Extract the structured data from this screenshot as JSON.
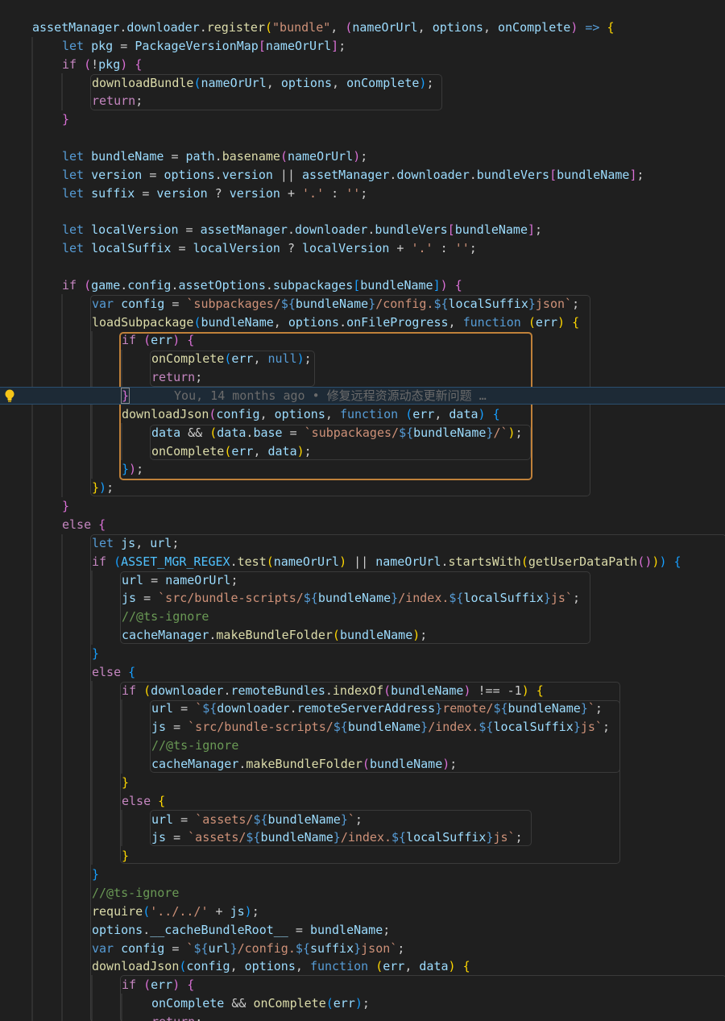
{
  "blame": "You, 14 months ago • 修复远程资源动态更新问题 …",
  "lines": [
    [
      [
        "v",
        "assetManager"
      ],
      [
        "p",
        "."
      ],
      [
        "v",
        "downloader"
      ],
      [
        "p",
        "."
      ],
      [
        "f",
        "register"
      ],
      [
        "b1",
        "("
      ],
      [
        "s",
        "\"bundle\""
      ],
      [
        "p",
        ", "
      ],
      [
        "b2",
        "("
      ],
      [
        "v",
        "nameOrUrl"
      ],
      [
        "p",
        ", "
      ],
      [
        "v",
        "options"
      ],
      [
        "p",
        ", "
      ],
      [
        "v",
        "onComplete"
      ],
      [
        "b2",
        ")"
      ],
      [
        "p",
        " "
      ],
      [
        "k",
        "=>"
      ],
      [
        "p",
        " "
      ],
      [
        "b1",
        "{"
      ]
    ],
    [
      [
        "k",
        "let"
      ],
      [
        "p",
        " "
      ],
      [
        "v",
        "pkg"
      ],
      [
        "p",
        " = "
      ],
      [
        "v",
        "PackageVersionMap"
      ],
      [
        "b2",
        "["
      ],
      [
        "v",
        "nameOrUrl"
      ],
      [
        "b2",
        "]"
      ],
      [
        "p",
        ";"
      ]
    ],
    [
      [
        "kc",
        "if"
      ],
      [
        "p",
        " "
      ],
      [
        "b2",
        "("
      ],
      [
        "p",
        "!"
      ],
      [
        "v",
        "pkg"
      ],
      [
        "b2",
        ")"
      ],
      [
        "p",
        " "
      ],
      [
        "b2",
        "{"
      ]
    ],
    [
      [
        "f",
        "downloadBundle"
      ],
      [
        "b3",
        "("
      ],
      [
        "v",
        "nameOrUrl"
      ],
      [
        "p",
        ", "
      ],
      [
        "v",
        "options"
      ],
      [
        "p",
        ", "
      ],
      [
        "v",
        "onComplete"
      ],
      [
        "b3",
        ")"
      ],
      [
        "p",
        ";"
      ]
    ],
    [
      [
        "kc",
        "return"
      ],
      [
        "p",
        ";"
      ]
    ],
    [
      [
        "b2",
        "}"
      ]
    ],
    [],
    [
      [
        "k",
        "let"
      ],
      [
        "p",
        " "
      ],
      [
        "v",
        "bundleName"
      ],
      [
        "p",
        " = "
      ],
      [
        "v",
        "path"
      ],
      [
        "p",
        "."
      ],
      [
        "f",
        "basename"
      ],
      [
        "b2",
        "("
      ],
      [
        "v",
        "nameOrUrl"
      ],
      [
        "b2",
        ")"
      ],
      [
        "p",
        ";"
      ]
    ],
    [
      [
        "k",
        "let"
      ],
      [
        "p",
        " "
      ],
      [
        "v",
        "version"
      ],
      [
        "p",
        " = "
      ],
      [
        "v",
        "options"
      ],
      [
        "p",
        "."
      ],
      [
        "v",
        "version"
      ],
      [
        "p",
        " || "
      ],
      [
        "v",
        "assetManager"
      ],
      [
        "p",
        "."
      ],
      [
        "v",
        "downloader"
      ],
      [
        "p",
        "."
      ],
      [
        "v",
        "bundleVers"
      ],
      [
        "b2",
        "["
      ],
      [
        "v",
        "bundleName"
      ],
      [
        "b2",
        "]"
      ],
      [
        "p",
        ";"
      ]
    ],
    [
      [
        "k",
        "let"
      ],
      [
        "p",
        " "
      ],
      [
        "v",
        "suffix"
      ],
      [
        "p",
        " = "
      ],
      [
        "v",
        "version"
      ],
      [
        "p",
        " ? "
      ],
      [
        "v",
        "version"
      ],
      [
        "p",
        " + "
      ],
      [
        "s",
        "'.'"
      ],
      [
        "p",
        " : "
      ],
      [
        "s",
        "''"
      ],
      [
        "p",
        ";"
      ]
    ],
    [],
    [
      [
        "k",
        "let"
      ],
      [
        "p",
        " "
      ],
      [
        "v",
        "localVersion"
      ],
      [
        "p",
        " = "
      ],
      [
        "v",
        "assetManager"
      ],
      [
        "p",
        "."
      ],
      [
        "v",
        "downloader"
      ],
      [
        "p",
        "."
      ],
      [
        "v",
        "bundleVers"
      ],
      [
        "b2",
        "["
      ],
      [
        "v",
        "bundleName"
      ],
      [
        "b2",
        "]"
      ],
      [
        "p",
        ";"
      ]
    ],
    [
      [
        "k",
        "let"
      ],
      [
        "p",
        " "
      ],
      [
        "v",
        "localSuffix"
      ],
      [
        "p",
        " = "
      ],
      [
        "v",
        "localVersion"
      ],
      [
        "p",
        " ? "
      ],
      [
        "v",
        "localVersion"
      ],
      [
        "p",
        " + "
      ],
      [
        "s",
        "'.'"
      ],
      [
        "p",
        " : "
      ],
      [
        "s",
        "''"
      ],
      [
        "p",
        ";"
      ]
    ],
    [],
    [
      [
        "kc",
        "if"
      ],
      [
        "p",
        " "
      ],
      [
        "b2",
        "("
      ],
      [
        "v",
        "game"
      ],
      [
        "p",
        "."
      ],
      [
        "v",
        "config"
      ],
      [
        "p",
        "."
      ],
      [
        "v",
        "assetOptions"
      ],
      [
        "p",
        "."
      ],
      [
        "v",
        "subpackages"
      ],
      [
        "b3",
        "["
      ],
      [
        "v",
        "bundleName"
      ],
      [
        "b3",
        "]"
      ],
      [
        "b2",
        ")"
      ],
      [
        "p",
        " "
      ],
      [
        "b2",
        "{"
      ]
    ],
    [
      [
        "k",
        "var"
      ],
      [
        "p",
        " "
      ],
      [
        "v",
        "config"
      ],
      [
        "p",
        " = "
      ],
      [
        "s",
        "`subpackages/"
      ],
      [
        "k",
        "${"
      ],
      [
        "v",
        "bundleName"
      ],
      [
        "k",
        "}"
      ],
      [
        "s",
        "/config."
      ],
      [
        "k",
        "${"
      ],
      [
        "v",
        "localSuffix"
      ],
      [
        "k",
        "}"
      ],
      [
        "s",
        "json`"
      ],
      [
        "p",
        ";"
      ]
    ],
    [
      [
        "f",
        "loadSubpackage"
      ],
      [
        "b3",
        "("
      ],
      [
        "v",
        "bundleName"
      ],
      [
        "p",
        ", "
      ],
      [
        "v",
        "options"
      ],
      [
        "p",
        "."
      ],
      [
        "v",
        "onFileProgress"
      ],
      [
        "p",
        ", "
      ],
      [
        "k",
        "function"
      ],
      [
        "p",
        " "
      ],
      [
        "b1",
        "("
      ],
      [
        "v",
        "err"
      ],
      [
        "b1",
        ")"
      ],
      [
        "p",
        " "
      ],
      [
        "b1",
        "{"
      ]
    ],
    [
      [
        "kc",
        "if"
      ],
      [
        "p",
        " "
      ],
      [
        "b2",
        "("
      ],
      [
        "v",
        "err"
      ],
      [
        "b2",
        ")"
      ],
      [
        "p",
        " "
      ],
      [
        "b2",
        "{"
      ]
    ],
    [
      [
        "f",
        "onComplete"
      ],
      [
        "b3",
        "("
      ],
      [
        "v",
        "err"
      ],
      [
        "p",
        ", "
      ],
      [
        "n",
        "null"
      ],
      [
        "b3",
        ")"
      ],
      [
        "p",
        ";"
      ]
    ],
    [
      [
        "kc",
        "return"
      ],
      [
        "p",
        ";"
      ]
    ],
    [
      [
        "b2",
        "}"
      ]
    ],
    [
      [
        "f",
        "downloadJson"
      ],
      [
        "b2",
        "("
      ],
      [
        "v",
        "config"
      ],
      [
        "p",
        ", "
      ],
      [
        "v",
        "options"
      ],
      [
        "p",
        ", "
      ],
      [
        "k",
        "function"
      ],
      [
        "p",
        " "
      ],
      [
        "b3",
        "("
      ],
      [
        "v",
        "err"
      ],
      [
        "p",
        ", "
      ],
      [
        "v",
        "data"
      ],
      [
        "b3",
        ")"
      ],
      [
        "p",
        " "
      ],
      [
        "b3",
        "{"
      ]
    ],
    [
      [
        "v",
        "data"
      ],
      [
        "p",
        " && "
      ],
      [
        "b1",
        "("
      ],
      [
        "v",
        "data"
      ],
      [
        "p",
        "."
      ],
      [
        "v",
        "base"
      ],
      [
        "p",
        " = "
      ],
      [
        "s",
        "`subpackages/"
      ],
      [
        "k",
        "${"
      ],
      [
        "v",
        "bundleName"
      ],
      [
        "k",
        "}"
      ],
      [
        "s",
        "/`"
      ],
      [
        "b1",
        ")"
      ],
      [
        "p",
        ";"
      ]
    ],
    [
      [
        "f",
        "onComplete"
      ],
      [
        "b1",
        "("
      ],
      [
        "v",
        "err"
      ],
      [
        "p",
        ", "
      ],
      [
        "v",
        "data"
      ],
      [
        "b1",
        ")"
      ],
      [
        "p",
        ";"
      ]
    ],
    [
      [
        "b3",
        "}"
      ],
      [
        "b2",
        ")"
      ],
      [
        "p",
        ";"
      ]
    ],
    [
      [
        "b1",
        "}"
      ],
      [
        "b3",
        ")"
      ],
      [
        "p",
        ";"
      ]
    ],
    [
      [
        "b2",
        "}"
      ]
    ],
    [
      [
        "kc",
        "else"
      ],
      [
        "p",
        " "
      ],
      [
        "b2",
        "{"
      ]
    ],
    [
      [
        "k",
        "let"
      ],
      [
        "p",
        " "
      ],
      [
        "v",
        "js"
      ],
      [
        "p",
        ", "
      ],
      [
        "v",
        "url"
      ],
      [
        "p",
        ";"
      ]
    ],
    [
      [
        "kc",
        "if"
      ],
      [
        "p",
        " "
      ],
      [
        "b3",
        "("
      ],
      [
        "cn",
        "ASSET_MGR_REGEX"
      ],
      [
        "p",
        "."
      ],
      [
        "f",
        "test"
      ],
      [
        "b1",
        "("
      ],
      [
        "v",
        "nameOrUrl"
      ],
      [
        "b1",
        ")"
      ],
      [
        "p",
        " || "
      ],
      [
        "v",
        "nameOrUrl"
      ],
      [
        "p",
        "."
      ],
      [
        "f",
        "startsWith"
      ],
      [
        "b1",
        "("
      ],
      [
        "f",
        "getUserDataPath"
      ],
      [
        "b2",
        "()"
      ],
      [
        "b1",
        ")"
      ],
      [
        "b3",
        ")"
      ],
      [
        "p",
        " "
      ],
      [
        "b3",
        "{"
      ]
    ],
    [
      [
        "v",
        "url"
      ],
      [
        "p",
        " = "
      ],
      [
        "v",
        "nameOrUrl"
      ],
      [
        "p",
        ";"
      ]
    ],
    [
      [
        "v",
        "js"
      ],
      [
        "p",
        " = "
      ],
      [
        "s",
        "`src/bundle-scripts/"
      ],
      [
        "k",
        "${"
      ],
      [
        "v",
        "bundleName"
      ],
      [
        "k",
        "}"
      ],
      [
        "s",
        "/index."
      ],
      [
        "k",
        "${"
      ],
      [
        "v",
        "localSuffix"
      ],
      [
        "k",
        "}"
      ],
      [
        "s",
        "js`"
      ],
      [
        "p",
        ";"
      ]
    ],
    [
      [
        "c",
        "//@ts-ignore"
      ]
    ],
    [
      [
        "v",
        "cacheManager"
      ],
      [
        "p",
        "."
      ],
      [
        "f",
        "makeBundleFolder"
      ],
      [
        "b1",
        "("
      ],
      [
        "v",
        "bundleName"
      ],
      [
        "b1",
        ")"
      ],
      [
        "p",
        ";"
      ]
    ],
    [
      [
        "b3",
        "}"
      ]
    ],
    [
      [
        "kc",
        "else"
      ],
      [
        "p",
        " "
      ],
      [
        "b3",
        "{"
      ]
    ],
    [
      [
        "kc",
        "if"
      ],
      [
        "p",
        " "
      ],
      [
        "b1",
        "("
      ],
      [
        "v",
        "downloader"
      ],
      [
        "p",
        "."
      ],
      [
        "v",
        "remoteBundles"
      ],
      [
        "p",
        "."
      ],
      [
        "f",
        "indexOf"
      ],
      [
        "b2",
        "("
      ],
      [
        "v",
        "bundleName"
      ],
      [
        "b2",
        ")"
      ],
      [
        "p",
        " !== -1"
      ],
      [
        "b1",
        ")"
      ],
      [
        "p",
        " "
      ],
      [
        "b1",
        "{"
      ]
    ],
    [
      [
        "v",
        "url"
      ],
      [
        "p",
        " = "
      ],
      [
        "s",
        "`"
      ],
      [
        "k",
        "${"
      ],
      [
        "v",
        "downloader"
      ],
      [
        "p",
        "."
      ],
      [
        "v",
        "remoteServerAddress"
      ],
      [
        "k",
        "}"
      ],
      [
        "s",
        "remote/"
      ],
      [
        "k",
        "${"
      ],
      [
        "v",
        "bundleName"
      ],
      [
        "k",
        "}"
      ],
      [
        "s",
        "`"
      ],
      [
        "p",
        ";"
      ]
    ],
    [
      [
        "v",
        "js"
      ],
      [
        "p",
        " = "
      ],
      [
        "s",
        "`src/bundle-scripts/"
      ],
      [
        "k",
        "${"
      ],
      [
        "v",
        "bundleName"
      ],
      [
        "k",
        "}"
      ],
      [
        "s",
        "/index."
      ],
      [
        "k",
        "${"
      ],
      [
        "v",
        "localSuffix"
      ],
      [
        "k",
        "}"
      ],
      [
        "s",
        "js`"
      ],
      [
        "p",
        ";"
      ]
    ],
    [
      [
        "c",
        "//@ts-ignore"
      ]
    ],
    [
      [
        "v",
        "cacheManager"
      ],
      [
        "p",
        "."
      ],
      [
        "f",
        "makeBundleFolder"
      ],
      [
        "b2",
        "("
      ],
      [
        "v",
        "bundleName"
      ],
      [
        "b2",
        ")"
      ],
      [
        "p",
        ";"
      ]
    ],
    [
      [
        "b1",
        "}"
      ]
    ],
    [
      [
        "kc",
        "else"
      ],
      [
        "p",
        " "
      ],
      [
        "b1",
        "{"
      ]
    ],
    [
      [
        "v",
        "url"
      ],
      [
        "p",
        " = "
      ],
      [
        "s",
        "`assets/"
      ],
      [
        "k",
        "${"
      ],
      [
        "v",
        "bundleName"
      ],
      [
        "k",
        "}"
      ],
      [
        "s",
        "`"
      ],
      [
        "p",
        ";"
      ]
    ],
    [
      [
        "v",
        "js"
      ],
      [
        "p",
        " = "
      ],
      [
        "s",
        "`assets/"
      ],
      [
        "k",
        "${"
      ],
      [
        "v",
        "bundleName"
      ],
      [
        "k",
        "}"
      ],
      [
        "s",
        "/index."
      ],
      [
        "k",
        "${"
      ],
      [
        "v",
        "localSuffix"
      ],
      [
        "k",
        "}"
      ],
      [
        "s",
        "js`"
      ],
      [
        "p",
        ";"
      ]
    ],
    [
      [
        "b1",
        "}"
      ]
    ],
    [
      [
        "b3",
        "}"
      ]
    ],
    [
      [
        "c",
        "//@ts-ignore"
      ]
    ],
    [
      [
        "f",
        "require"
      ],
      [
        "b3",
        "("
      ],
      [
        "s",
        "'../../'"
      ],
      [
        "p",
        " + "
      ],
      [
        "v",
        "js"
      ],
      [
        "b3",
        ")"
      ],
      [
        "p",
        ";"
      ]
    ],
    [
      [
        "v",
        "options"
      ],
      [
        "p",
        "."
      ],
      [
        "v",
        "__cacheBundleRoot__"
      ],
      [
        "p",
        " = "
      ],
      [
        "v",
        "bundleName"
      ],
      [
        "p",
        ";"
      ]
    ],
    [
      [
        "k",
        "var"
      ],
      [
        "p",
        " "
      ],
      [
        "v",
        "config"
      ],
      [
        "p",
        " = "
      ],
      [
        "s",
        "`"
      ],
      [
        "k",
        "${"
      ],
      [
        "v",
        "url"
      ],
      [
        "k",
        "}"
      ],
      [
        "s",
        "/config."
      ],
      [
        "k",
        "${"
      ],
      [
        "v",
        "suffix"
      ],
      [
        "k",
        "}"
      ],
      [
        "s",
        "json`"
      ],
      [
        "p",
        ";"
      ]
    ],
    [
      [
        "f",
        "downloadJson"
      ],
      [
        "b3",
        "("
      ],
      [
        "v",
        "config"
      ],
      [
        "p",
        ", "
      ],
      [
        "v",
        "options"
      ],
      [
        "p",
        ", "
      ],
      [
        "k",
        "function"
      ],
      [
        "p",
        " "
      ],
      [
        "b1",
        "("
      ],
      [
        "v",
        "err"
      ],
      [
        "p",
        ", "
      ],
      [
        "v",
        "data"
      ],
      [
        "b1",
        ")"
      ],
      [
        "p",
        " "
      ],
      [
        "b1",
        "{"
      ]
    ],
    [
      [
        "kc",
        "if"
      ],
      [
        "p",
        " "
      ],
      [
        "b2",
        "("
      ],
      [
        "v",
        "err"
      ],
      [
        "b2",
        ")"
      ],
      [
        "p",
        " "
      ],
      [
        "b2",
        "{"
      ]
    ],
    [
      [
        "v",
        "onComplete"
      ],
      [
        "p",
        " && "
      ],
      [
        "f",
        "onComplete"
      ],
      [
        "b3",
        "("
      ],
      [
        "v",
        "err"
      ],
      [
        "b3",
        ")"
      ],
      [
        "p",
        ";"
      ]
    ],
    [
      [
        "kc",
        "return"
      ],
      [
        "p",
        ";"
      ]
    ]
  ]
}
